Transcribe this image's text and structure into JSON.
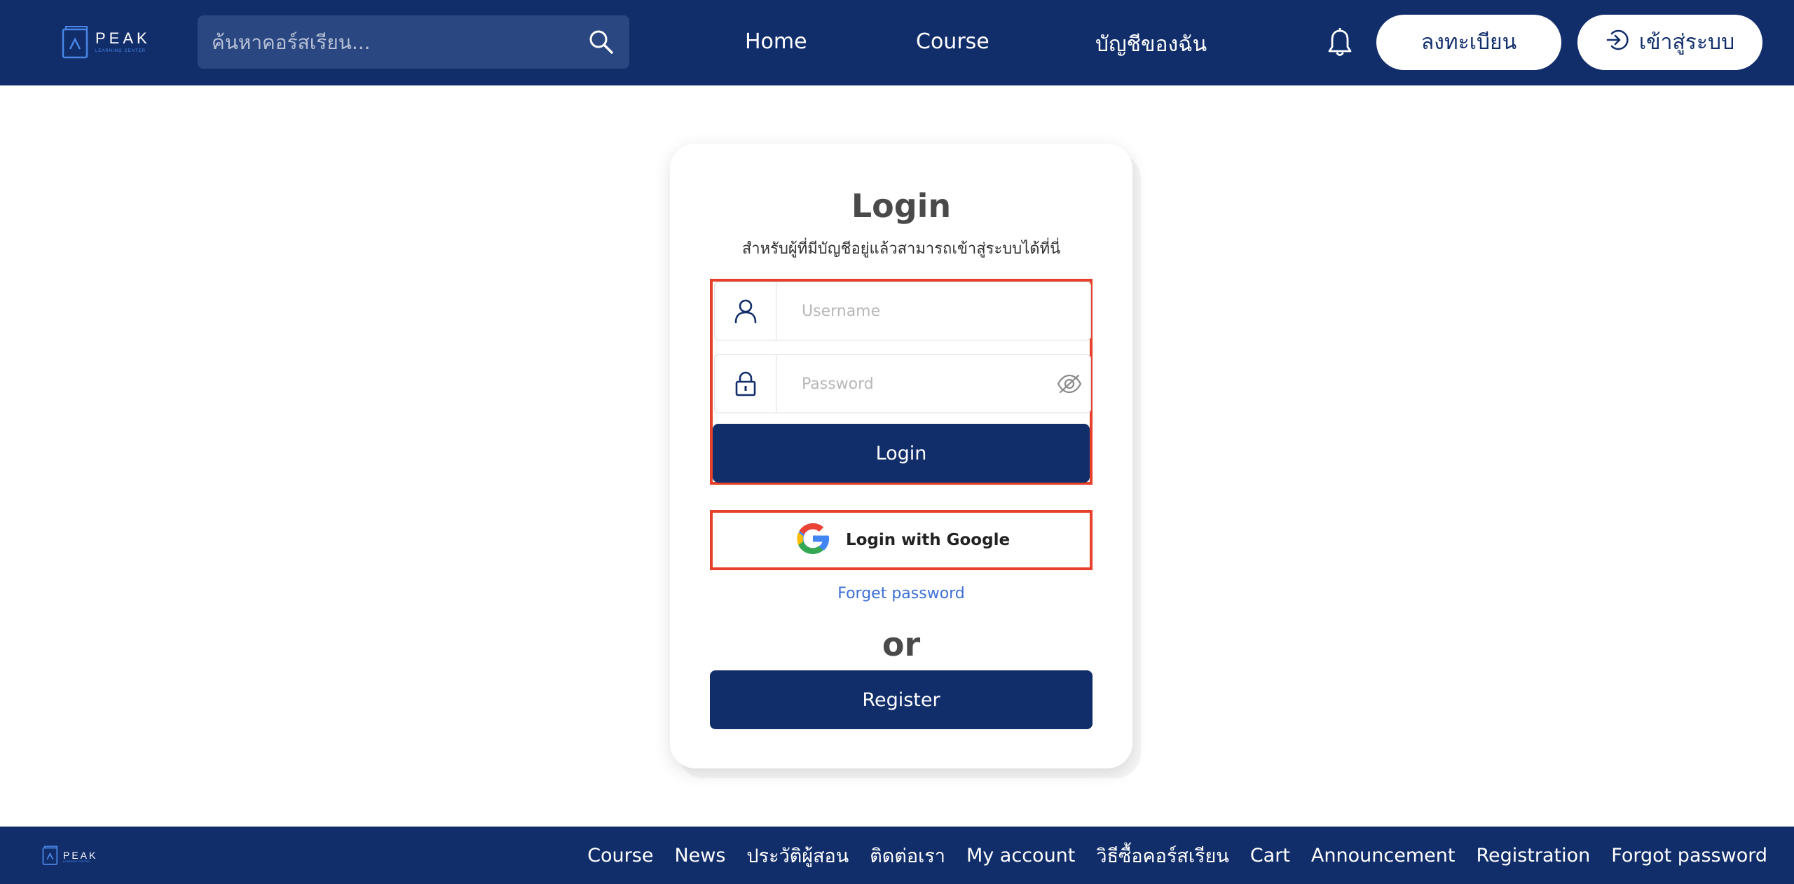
{
  "header": {
    "logo_word": "PEAK",
    "logo_sub": "LEARNING CENTER",
    "search_placeholder": "ค้นหาคอร์สเรียน...",
    "nav": [
      "Home",
      "Course",
      "บัญชีของฉัน"
    ],
    "register_label": "ลงทะเบียน",
    "login_label": "เข้าสู่ระบบ"
  },
  "login_card": {
    "title": "Login",
    "subtitle": "สำหรับผู้ที่มีบัญชีอยู่แล้วสามารถเข้าสู่ระบบได้ที่นี่",
    "username_placeholder": "Username",
    "password_placeholder": "Password",
    "login_button": "Login",
    "google_button": "Login with Google",
    "forget_password": "Forget password",
    "or_text": "or",
    "register_button": "Register"
  },
  "footer": {
    "logo_word": "PEAK",
    "logo_sub": "LEARNING CENTER",
    "links": [
      "Course",
      "News",
      "ประวัติผู้สอน",
      "ติดต่อเรา",
      "My account",
      "วิธีซื้อคอร์สเรียน",
      "Cart",
      "Announcement",
      "Registration",
      "Forgot password"
    ]
  },
  "colors": {
    "primary": "#112e6b",
    "highlight": "#e8412b",
    "link": "#3d6fd6"
  }
}
